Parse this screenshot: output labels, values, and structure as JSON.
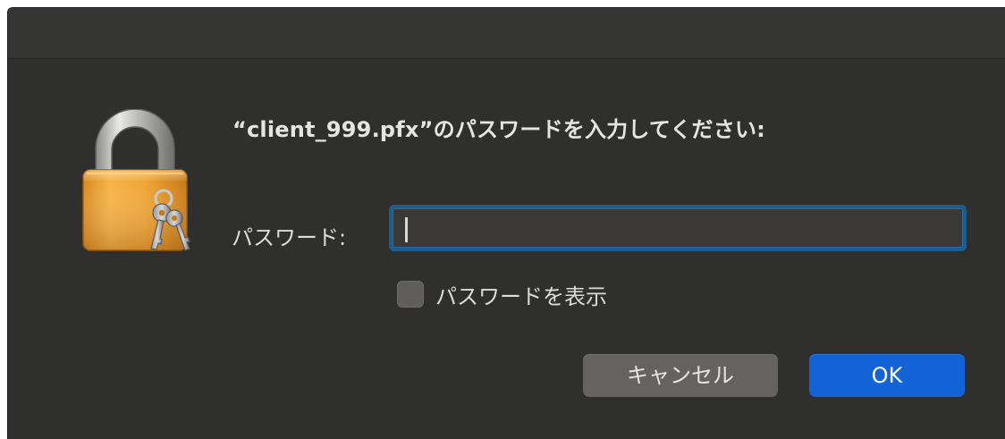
{
  "dialog": {
    "prompt": "“client_999.pfx”のパスワードを入力してください:",
    "password_label": "パスワード:",
    "password_value": "",
    "show_password_label": "パスワードを表示",
    "show_password_checked": false,
    "cancel_label": "キャンセル",
    "ok_label": "OK"
  },
  "icons": {
    "main": "keychain-lock-icon"
  },
  "colors": {
    "dialog_bg": "#2f2f2d",
    "field_focus_ring": "#1c5d8f",
    "ok_button": "#1264d6",
    "cancel_button": "#646361",
    "lock_body": "#f0a534"
  }
}
